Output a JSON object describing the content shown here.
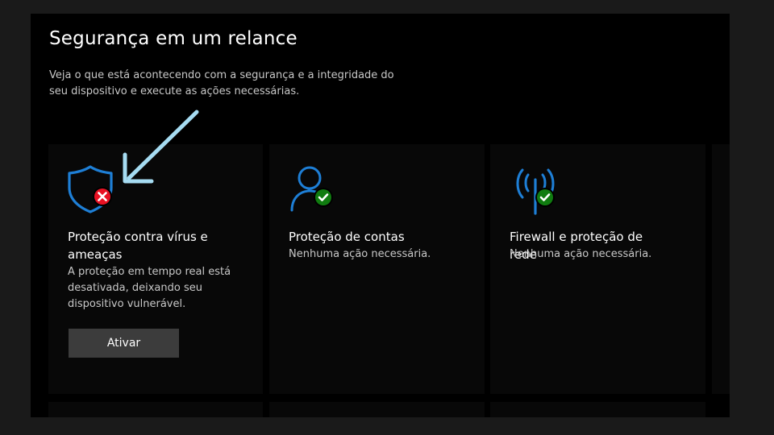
{
  "header": {
    "title": "Segurança em um relance",
    "description": "Veja o que está acontecendo com a segurança e a integridade do seu dispositivo e execute as ações necessárias."
  },
  "cards": [
    {
      "title": "Proteção contra vírus e ameaças",
      "status": "A proteção em tempo real está desativada, deixando seu dispositivo vulnerável.",
      "button": "Ativar",
      "icon": "shield-icon",
      "badge": "error-badge-icon",
      "state": "error"
    },
    {
      "title": "Proteção de contas",
      "status": "Nenhuma ação necessária.",
      "icon": "person-icon",
      "badge": "check-badge-icon",
      "state": "ok"
    },
    {
      "title": "Firewall e proteção de rede",
      "status": "Nenhuma ação necessária.",
      "icon": "wifi-antenna-icon",
      "badge": "check-badge-icon",
      "state": "ok"
    }
  ],
  "colors": {
    "accent": "#1e7fd6",
    "error": "#e81123",
    "success": "#107c10",
    "annotation": "#a6dcf2"
  }
}
